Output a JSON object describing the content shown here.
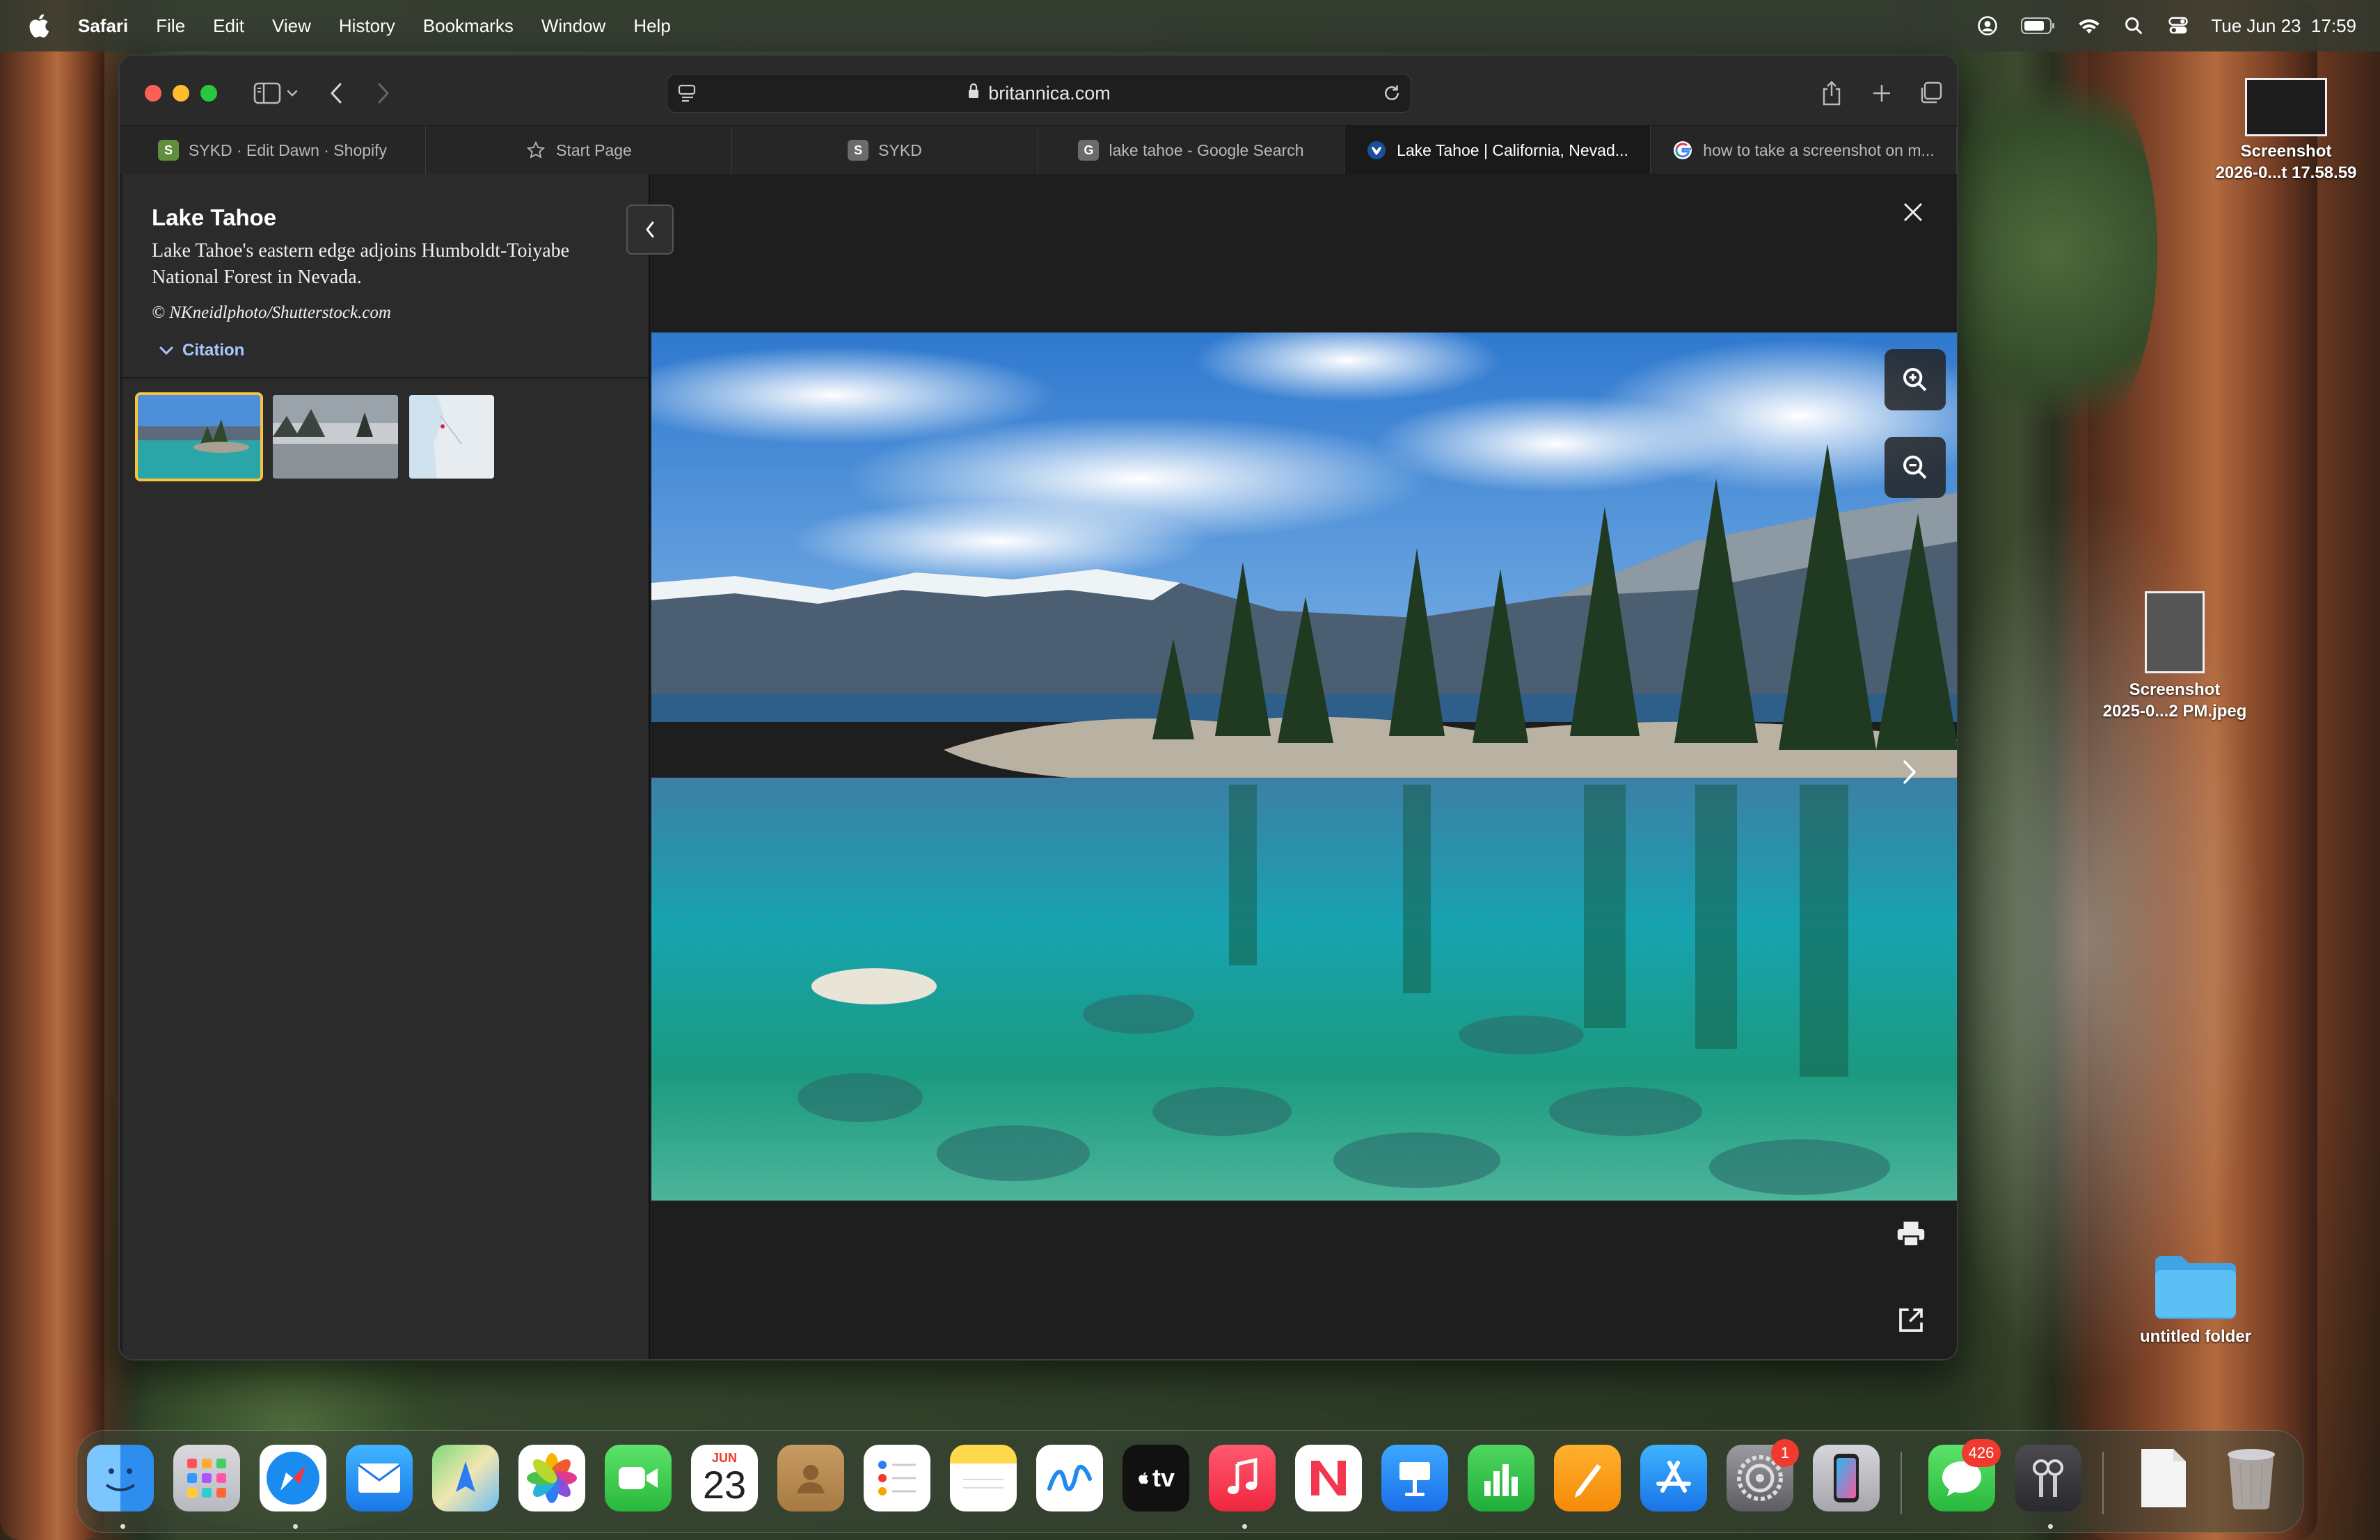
{
  "menubar": {
    "app_name": "Safari",
    "items": [
      "File",
      "Edit",
      "View",
      "History",
      "Bookmarks",
      "Window",
      "Help"
    ],
    "datetime": "Tue Jun 23  17:59"
  },
  "browser": {
    "url": "britannica.com",
    "tabs": [
      {
        "label": "SYKD · Edit Dawn · Shopify",
        "icon": "shopify-icon",
        "active": false
      },
      {
        "label": "Start Page",
        "icon": "star-icon",
        "active": false
      },
      {
        "label": "SYKD",
        "icon": "s-favicon",
        "active": false
      },
      {
        "label": "lake tahoe - Google Search",
        "icon": "g-favicon",
        "active": false
      },
      {
        "label": "Lake Tahoe | California, Nevad...",
        "icon": "britannica-icon",
        "active": true
      },
      {
        "label": "how to take a screenshot on m...",
        "icon": "google-icon",
        "active": false
      }
    ]
  },
  "media_panel": {
    "title": "Lake Tahoe",
    "caption": "Lake Tahoe's eastern edge adjoins Humboldt-Toiyabe National Forest in Nevada.",
    "credit": "© NKneidlphoto/Shutterstock.com",
    "citation_label": "Citation"
  },
  "desktop": {
    "icons": [
      {
        "label_line1": "Screenshot",
        "label_line2": "2026-0...t 17.58.59"
      },
      {
        "label_line1": "Screenshot",
        "label_line2": "2025-0...2 PM.jpeg"
      },
      {
        "label_line1": "untitled folder",
        "label_line2": ""
      }
    ]
  },
  "dock": {
    "calendar_month": "JUN",
    "calendar_day": "23",
    "tv_label": "tv",
    "settings_badge": "1",
    "messages_badge": "426",
    "apps": [
      "finder-icon",
      "launchpad-icon",
      "safari-icon",
      "mail-icon",
      "maps-icon",
      "photos-icon",
      "facetime-icon",
      "calendar-icon",
      "contacts-icon",
      "reminders-icon",
      "notes-icon",
      "freeform-icon",
      "apple-tv-icon",
      "music-icon",
      "news-icon",
      "keynote-icon",
      "numbers-icon",
      "pages-icon",
      "app-store-icon",
      "system-settings-icon",
      "iphone-mirroring-icon",
      "messages-icon",
      "keychain-icon",
      "document-icon",
      "trash-icon"
    ]
  },
  "colors": {
    "accent_link": "#a9c6ff",
    "selected_thumb": "#f5c542",
    "badge": "#f03a2f"
  }
}
